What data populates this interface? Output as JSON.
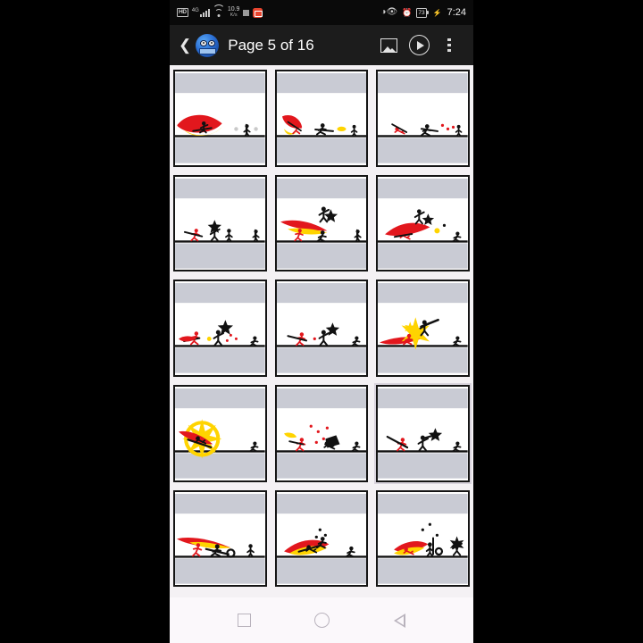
{
  "statusbar": {
    "hd_label": "HD",
    "network_gen": "4G",
    "signal_icon": "signal-bars-icon",
    "wifi_icon": "wifi-icon",
    "data_rate_value": "10.9",
    "data_rate_unit": "K/s",
    "notif_square_icon": "screen-record-icon",
    "notif_red_icon": "app-notification-icon",
    "eye_icon": "eye-comfort-icon",
    "alarm_icon": "alarm-clock-icon",
    "battery_percent": "73",
    "charging_icon": "charging-bolt-icon",
    "time": "7:24"
  },
  "appbar": {
    "back_icon": "back-chevron-icon",
    "app_logo_icon": "app-logo-icon",
    "title": "Page 5 of 16",
    "gallery_icon": "image-gallery-icon",
    "play_icon": "play-preview-icon",
    "overflow_icon": "overflow-menu-icon"
  },
  "grid": {
    "columns": 3,
    "frames": [
      {
        "index": "1",
        "name": "frame-thumbnail-1",
        "selected": false,
        "caption": "red stick figure slash with flame trail, black figure standing right"
      },
      {
        "index": "2",
        "name": "frame-thumbnail-2",
        "selected": false,
        "caption": "red figure lunging, black figure with sword, muzzle flash"
      },
      {
        "index": "3",
        "name": "frame-thumbnail-3",
        "selected": false,
        "caption": "red figure falling back, black figure slashing, blood dots"
      },
      {
        "index": "4",
        "name": "frame-thumbnail-4",
        "selected": false,
        "caption": "red figure and black figure clash, black figure right"
      },
      {
        "index": "5",
        "name": "frame-thumbnail-5",
        "selected": false,
        "caption": "black figure leaping with sword, flame trail over red figure"
      },
      {
        "index": "6",
        "name": "frame-thumbnail-6",
        "selected": false,
        "caption": "black figure diving, red slash trail, spark burst"
      },
      {
        "index": "7",
        "name": "frame-thumbnail-7",
        "selected": false,
        "caption": "red figure shooting, black figure with large blade"
      },
      {
        "index": "8",
        "name": "frame-thumbnail-8",
        "selected": false,
        "caption": "red figure with spear, black figure swinging blade"
      },
      {
        "index": "9",
        "name": "frame-thumbnail-9",
        "selected": false,
        "caption": "yellow star impact burst, figures colliding"
      },
      {
        "index": "10",
        "name": "frame-thumbnail-10",
        "selected": false,
        "caption": "large yellow ring explosion over red and black figures"
      },
      {
        "index": "11",
        "name": "frame-thumbnail-11",
        "selected": false,
        "caption": "red figure firing, black figure knocked down, blood spray"
      },
      {
        "index": "12",
        "name": "frame-thumbnail-12",
        "selected": true,
        "caption": "red figure with blade, black figure with spinning weapon"
      },
      {
        "index": "13",
        "name": "frame-thumbnail-13",
        "selected": false,
        "caption": "long red flame slash, two figures grappling"
      },
      {
        "index": "14",
        "name": "frame-thumbnail-14",
        "selected": false,
        "caption": "red slash arc, black figure crouched, spark dots"
      },
      {
        "index": "15",
        "name": "frame-thumbnail-15",
        "selected": false,
        "caption": "red figure sliding, black figures right with pole"
      }
    ]
  },
  "navbar": {
    "recents_icon": "recents-square-icon",
    "home_icon": "home-circle-icon",
    "back_icon": "back-triangle-icon"
  },
  "colors": {
    "appbar_bg": "#1c1c1c",
    "statusbar_bg": "#0a0a0a",
    "content_bg": "#f4f1f4",
    "navbar_bg": "#fbf8fb",
    "frame_border": "#151515",
    "letterbox": "#c9cbd4",
    "red": "#e2171d",
    "yellow": "#ffd400",
    "black": "#111111"
  }
}
